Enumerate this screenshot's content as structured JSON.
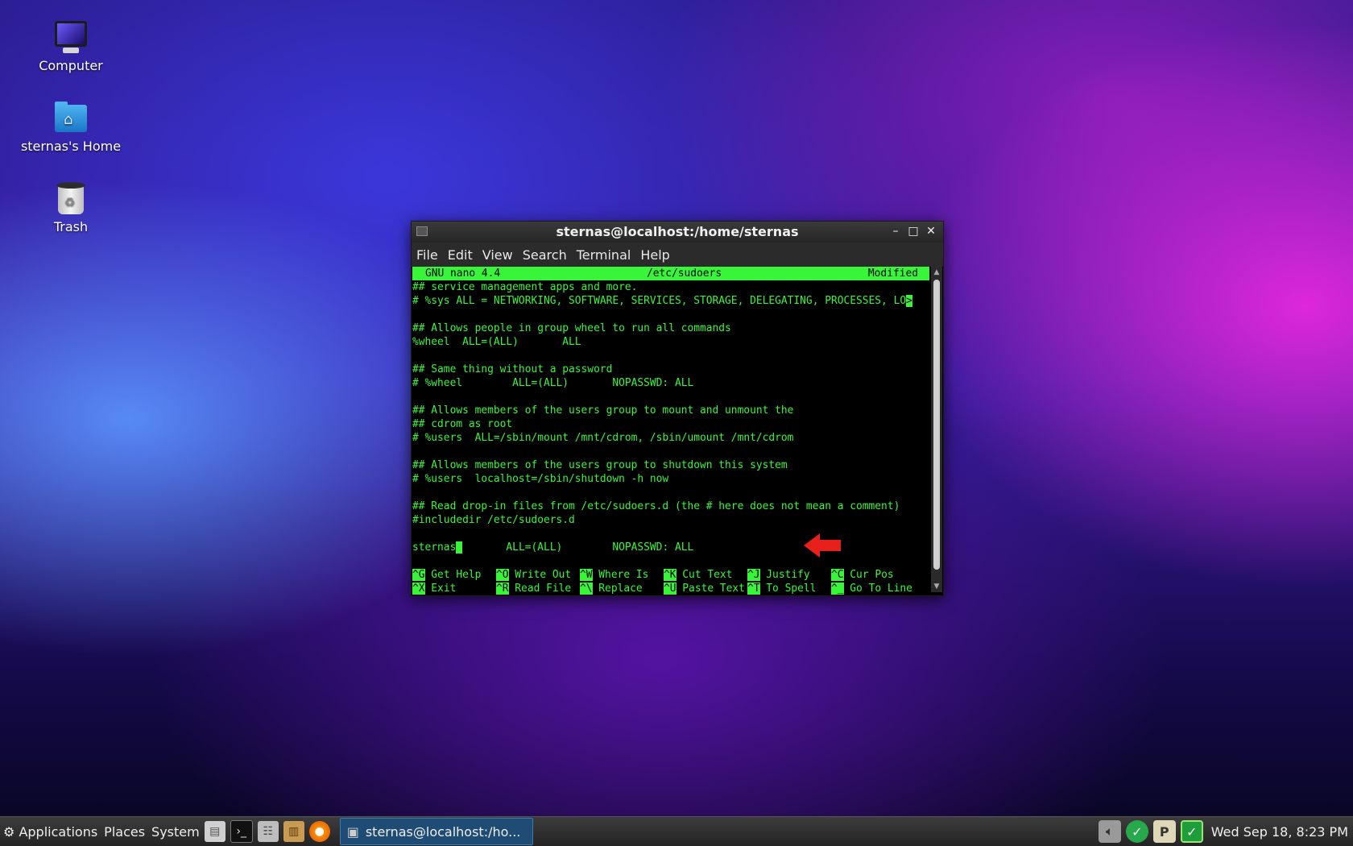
{
  "desktop": {
    "icons": [
      {
        "label": "Computer"
      },
      {
        "label": "sternas's Home"
      },
      {
        "label": "Trash"
      }
    ]
  },
  "window": {
    "title": "sternas@localhost:/home/sternas",
    "menu": [
      "File",
      "Edit",
      "View",
      "Search",
      "Terminal",
      "Help"
    ]
  },
  "nano": {
    "version": "GNU nano 4.4",
    "filename": "/etc/sudoers",
    "status": "Modified",
    "lines": [
      "## service management apps and more.",
      "# %sys ALL = NETWORKING, SOFTWARE, SERVICES, STORAGE, DELEGATING, PROCESSES, LO",
      "",
      "## Allows people in group wheel to run all commands",
      "%wheel  ALL=(ALL)       ALL",
      "",
      "## Same thing without a password",
      "# %wheel        ALL=(ALL)       NOPASSWD: ALL",
      "",
      "## Allows members of the users group to mount and unmount the",
      "## cdrom as root",
      "# %users  ALL=/sbin/mount /mnt/cdrom, /sbin/umount /mnt/cdrom",
      "",
      "## Allows members of the users group to shutdown this system",
      "# %users  localhost=/sbin/shutdown -h now",
      "",
      "## Read drop-in files from /etc/sudoers.d (the # here does not mean a comment)",
      "#includedir /etc/sudoers.d",
      ""
    ],
    "overflow_marker": ">",
    "edit_line": {
      "before": "sternas",
      "after": "       ALL=(ALL)        NOPASSWD: ALL"
    },
    "shortcuts_row1": [
      {
        "key": "^G",
        "label": " Get Help"
      },
      {
        "key": "^O",
        "label": " Write Out"
      },
      {
        "key": "^W",
        "label": " Where Is"
      },
      {
        "key": "^K",
        "label": " Cut Text"
      },
      {
        "key": "^J",
        "label": " Justify"
      },
      {
        "key": "^C",
        "label": " Cur Pos"
      }
    ],
    "shortcuts_row2": [
      {
        "key": "^X",
        "label": " Exit"
      },
      {
        "key": "^R",
        "label": " Read File"
      },
      {
        "key": "^\\",
        "label": " Replace"
      },
      {
        "key": "^U",
        "label": " Paste Text"
      },
      {
        "key": "^T",
        "label": " To Spell"
      },
      {
        "key": "^_",
        "label": " Go To Line"
      }
    ]
  },
  "taskbar": {
    "menus": [
      "Applications",
      "Places",
      "System"
    ],
    "task_label": "sternas@localhost:/ho...",
    "clock": "Wed Sep 18,  8:23 PM"
  },
  "colors": {
    "terminal_fg": "#39f539",
    "arrow": "#e8201c",
    "task_active": "#1f4c74"
  }
}
